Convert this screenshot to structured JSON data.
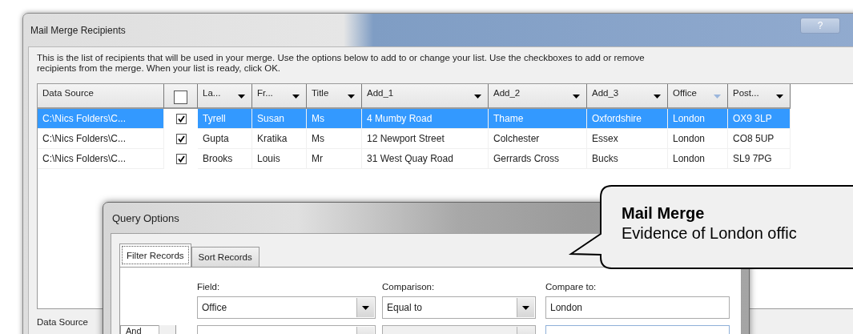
{
  "recipients_window": {
    "title": "Mail Merge Recipients",
    "help_button": "?",
    "description": [
      "This is the list of recipients that will be used in your merge.  Use the options below to add to or change your list.  Use the checkboxes to add or remove",
      "recipients from the merge.  When your list is ready, click OK."
    ],
    "table": {
      "select_all": {
        "checked": false
      },
      "columns": [
        {
          "kind": "text",
          "label": "Data Source"
        },
        {
          "kind": "dropdown",
          "label": "La...",
          "filtered": false
        },
        {
          "kind": "dropdown",
          "label": "Fr...",
          "filtered": false
        },
        {
          "kind": "dropdown",
          "label": "Title",
          "filtered": false
        },
        {
          "kind": "dropdown",
          "label": "Add_1",
          "filtered": false
        },
        {
          "kind": "dropdown",
          "label": "Add_2",
          "filtered": false
        },
        {
          "kind": "dropdown",
          "label": "Add_3",
          "filtered": false
        },
        {
          "kind": "dropdown",
          "label": "Office",
          "filtered": true
        },
        {
          "kind": "dropdown",
          "label": "Post...",
          "filtered": false
        }
      ],
      "rows": [
        {
          "selected": true,
          "checked": true,
          "cells": [
            "C:\\Nics Folders\\C...",
            "Tyrell",
            "Susan",
            "Ms",
            "4 Mumby Road",
            "Thame",
            "Oxfordshire",
            "London",
            "OX9 3LP"
          ]
        },
        {
          "selected": false,
          "checked": true,
          "cells": [
            "C:\\Nics Folders\\C...",
            "Gupta",
            "Kratika",
            "Ms",
            "12 Newport Street",
            "Colchester",
            "Essex",
            "London",
            "CO8 5UP"
          ]
        },
        {
          "selected": false,
          "checked": true,
          "cells": [
            "C:\\Nics Folders\\C...",
            "Brooks",
            "Louis",
            "Mr",
            "31 West Quay Road",
            "Gerrards Cross",
            "Bucks",
            "London",
            "SL9 7PG"
          ]
        }
      ]
    },
    "data_source_label": "Data Source"
  },
  "query_window": {
    "title": "Query Options",
    "tabs": [
      {
        "label": "Filter Records",
        "selected": true
      },
      {
        "label": "Sort Records",
        "selected": false
      }
    ],
    "labels": {
      "field": "Field:",
      "comparison": "Comparison:",
      "compare_to": "Compare to:"
    },
    "criteria": [
      {
        "field": "Office",
        "comparison": "Equal to",
        "value": "London"
      },
      {
        "conjunction": "And"
      }
    ]
  },
  "callout": {
    "title": "Mail Merge",
    "text": "Evidence of London offic"
  }
}
